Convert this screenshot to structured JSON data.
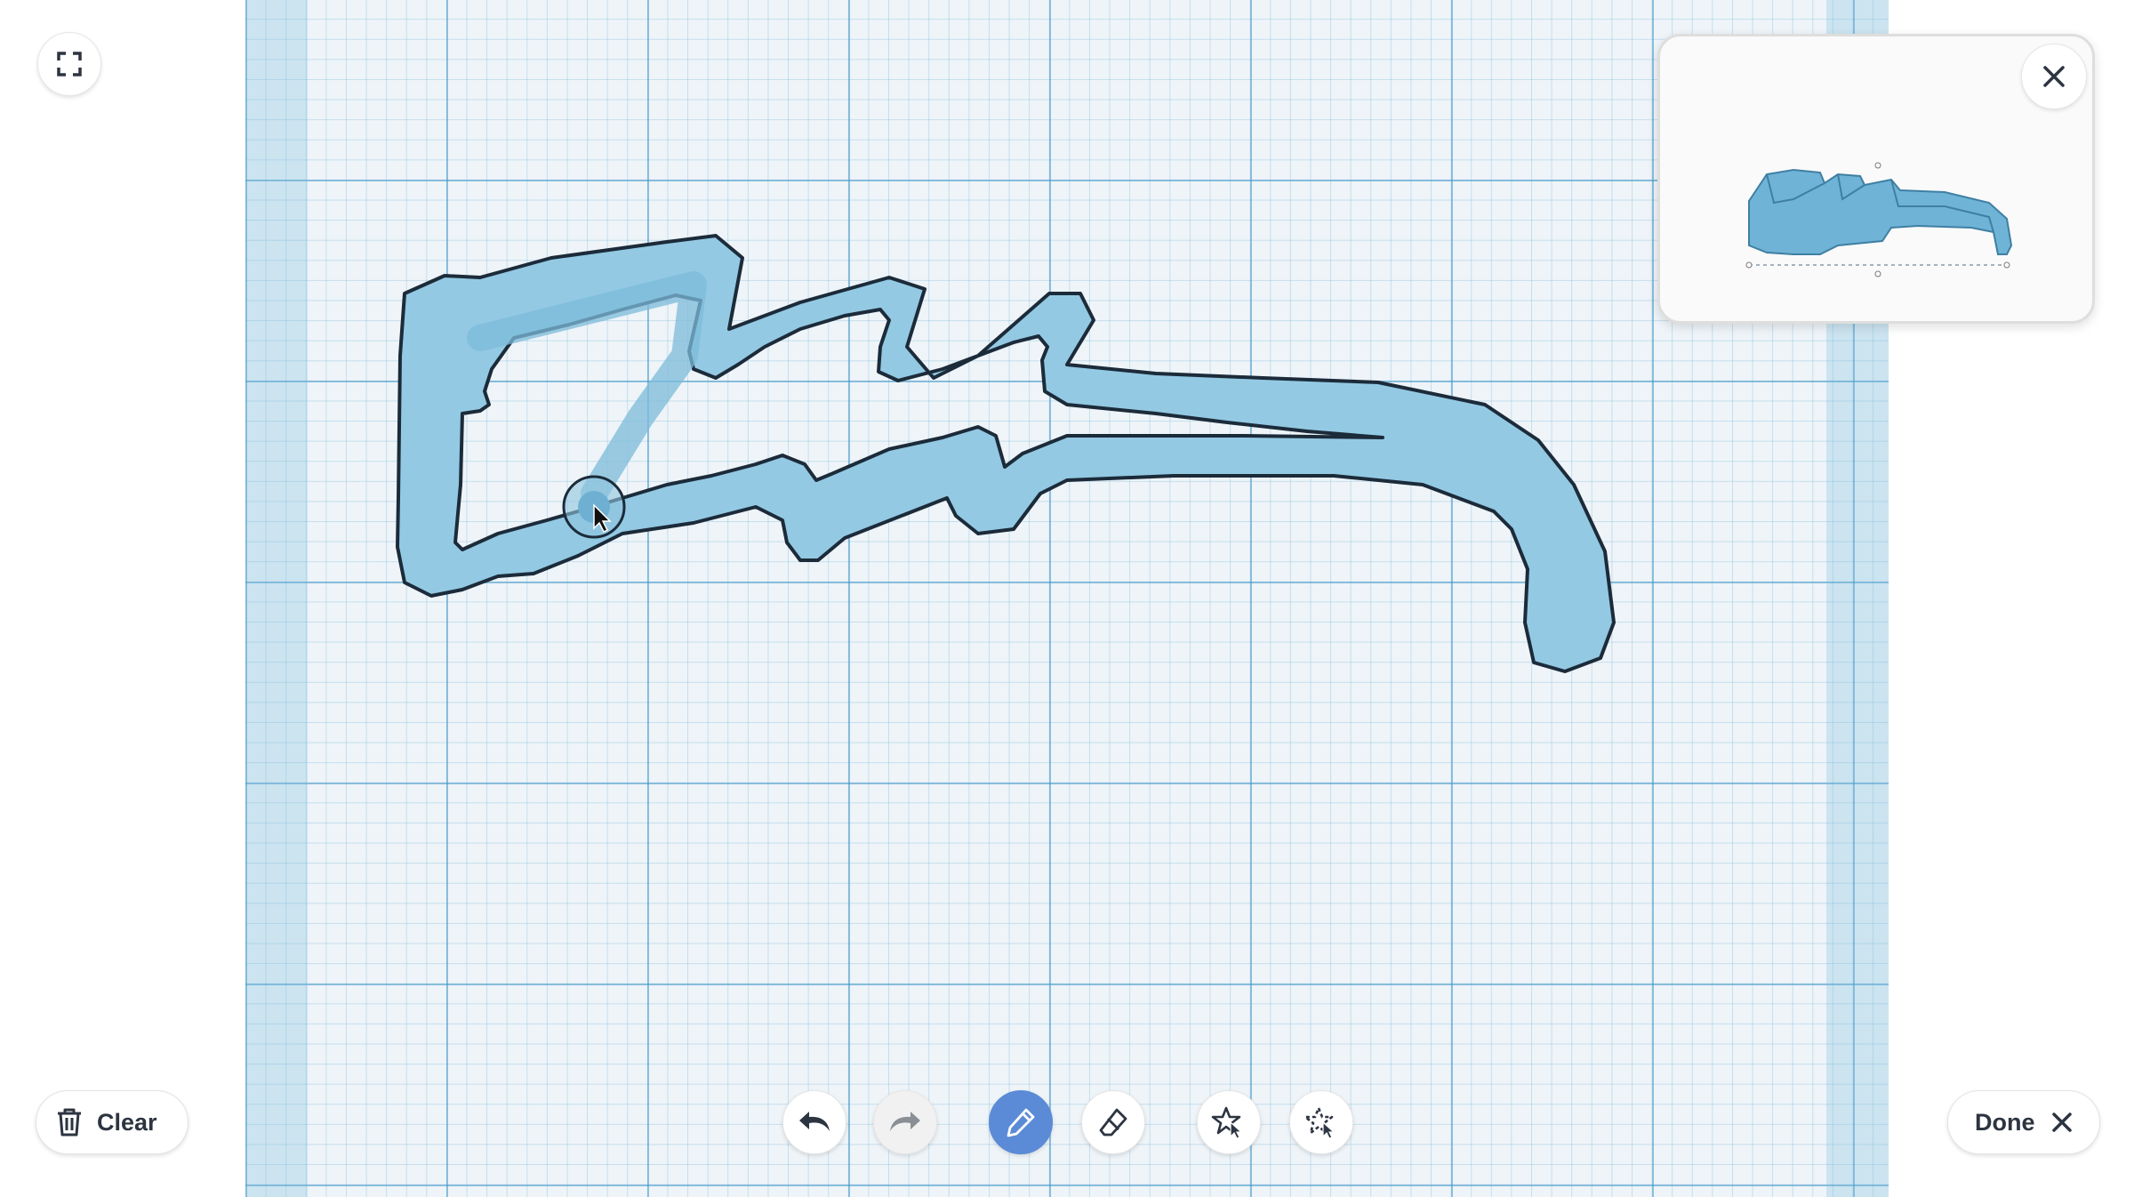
{
  "toolbar": {
    "clear_label": "Clear",
    "done_label": "Done",
    "tools": [
      {
        "name": "undo",
        "icon": "undo-arrow-icon",
        "state": "enabled"
      },
      {
        "name": "redo",
        "icon": "redo-arrow-icon",
        "state": "disabled"
      },
      {
        "name": "pencil",
        "icon": "pencil-icon",
        "state": "active"
      },
      {
        "name": "eraser",
        "icon": "eraser-icon",
        "state": "enabled"
      },
      {
        "name": "shape-select",
        "icon": "star-pointer-icon",
        "state": "enabled"
      },
      {
        "name": "shape-cut",
        "icon": "star-dashed-icon",
        "state": "enabled"
      }
    ]
  },
  "icons": {
    "fullscreen": "fullscreen-icon",
    "trash": "trash-icon",
    "close": "close-icon",
    "cursor": "brush-cursor-icon"
  },
  "colors": {
    "shape_fill": "#93c9e3",
    "shape_stroke": "#1c2b3a",
    "active_tool": "#5b8bd6",
    "grid_background": "#eef4f8",
    "preview_model": "#6fb3d6"
  }
}
